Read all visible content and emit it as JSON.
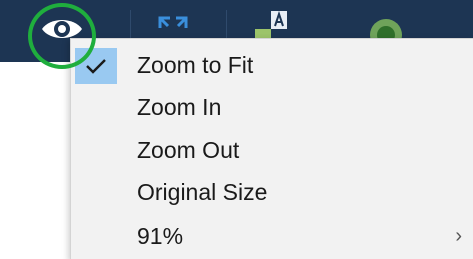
{
  "toolbar": {
    "buttons": [
      {
        "name": "eye-icon"
      },
      {
        "name": "expand-arrows-icon"
      },
      {
        "name": "text-size-icon"
      },
      {
        "name": "circle-icon"
      }
    ]
  },
  "menu": {
    "items": [
      {
        "label": "Zoom to Fit",
        "checked": true
      },
      {
        "label": "Zoom In"
      },
      {
        "label": "Zoom Out"
      },
      {
        "label": "Original Size"
      },
      {
        "label": "91%",
        "has_submenu": true
      }
    ],
    "submenu_arrow": "›"
  },
  "colors": {
    "toolbar": "#1d3553",
    "highlight_ring": "#1fae3d",
    "check_highlight": "#99c9f1",
    "menu_bg": "#f2f2f2"
  }
}
